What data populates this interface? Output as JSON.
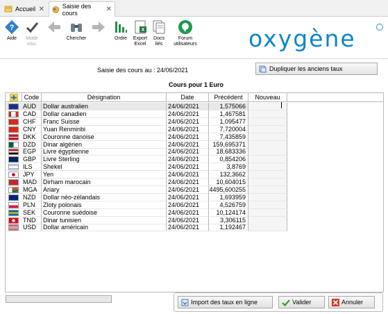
{
  "tabs": [
    {
      "label": "Accueil",
      "active": false
    },
    {
      "label": "Saisie des cours",
      "active": true
    }
  ],
  "toolbar": {
    "aide": "Aide",
    "mode_visu": "Mode\nvisu.",
    "chercher": "Chercher",
    "ordre": "Ordre",
    "export_excel": "Export\nExcel",
    "docs_lies": "Docs\nliés",
    "forum": "Forum\nutilisateurs"
  },
  "logo": "oxygène",
  "header": {
    "saisie_label": "Saisie des cours au : 24/06/2021",
    "dupliquer_label": "Dupliquer les anciens taux",
    "cours_title": "Cours pour 1 Euro"
  },
  "columns": {
    "code": "Code",
    "designation": "Désignation",
    "date": "Date",
    "precedent": "Précédent",
    "nouveau": "Nouveau"
  },
  "rows": [
    {
      "code": "AUD",
      "designation": "Dollar australien",
      "date": "24/06/2021",
      "precedent": "1,575066",
      "flag": "aud"
    },
    {
      "code": "CAD",
      "designation": "Dollar canadien",
      "date": "24/06/2021",
      "precedent": "1,467581",
      "flag": "cad"
    },
    {
      "code": "CHF",
      "designation": "Franc Suisse",
      "date": "24/06/2021",
      "precedent": "1,095477",
      "flag": "chf"
    },
    {
      "code": "CNY",
      "designation": "Yuan Renminbi",
      "date": "24/06/2021",
      "precedent": "7,720004",
      "flag": "cny"
    },
    {
      "code": "DKK",
      "designation": "Couronne danoise",
      "date": "24/06/2021",
      "precedent": "7,435859",
      "flag": "dkk"
    },
    {
      "code": "DZD",
      "designation": "Dinar algérien",
      "date": "24/06/2021",
      "precedent": "159,695371",
      "flag": "dzd"
    },
    {
      "code": "EGP",
      "designation": "Livre égyptienne",
      "date": "24/06/2021",
      "precedent": "18,683336",
      "flag": "egp"
    },
    {
      "code": "GBP",
      "designation": "Livre Sterling",
      "date": "24/06/2021",
      "precedent": "0,854206",
      "flag": "gbp"
    },
    {
      "code": "ILS",
      "designation": "Shekel",
      "date": "24/06/2021",
      "precedent": "3,8769",
      "flag": "ils"
    },
    {
      "code": "JPY",
      "designation": "Yen",
      "date": "24/06/2021",
      "precedent": "132,3662",
      "flag": "jpy"
    },
    {
      "code": "MAD",
      "designation": "Dirham marocain",
      "date": "24/06/2021",
      "precedent": "10,604015",
      "flag": "mad"
    },
    {
      "code": "MGA",
      "designation": "Ariary",
      "date": "24/06/2021",
      "precedent": "4495,600255",
      "flag": "mga"
    },
    {
      "code": "NZD",
      "designation": "Dollar néo-zélandais",
      "date": "24/06/2021",
      "precedent": "1,693959",
      "flag": "nzd"
    },
    {
      "code": "PLN",
      "designation": "Zloty polonais",
      "date": "24/06/2021",
      "precedent": "4,526759",
      "flag": "pln"
    },
    {
      "code": "SEK",
      "designation": "Couronne suédoise",
      "date": "24/06/2021",
      "precedent": "10,124174",
      "flag": "sek"
    },
    {
      "code": "TND",
      "designation": "Dinar tunisien",
      "date": "24/06/2021",
      "precedent": "3,306115",
      "flag": "tnd"
    },
    {
      "code": "USD",
      "designation": "Dollar américain",
      "date": "24/06/2021",
      "precedent": "1,192467",
      "flag": "usd"
    }
  ],
  "footer": {
    "import_label": "Import des taux en ligne",
    "valider_label": "Valider",
    "annuler_label": "Annuler"
  },
  "colors": {
    "brand": "#0d86c8",
    "valider_check": "#3a9a2b",
    "annuler_x": "#d9342b"
  }
}
